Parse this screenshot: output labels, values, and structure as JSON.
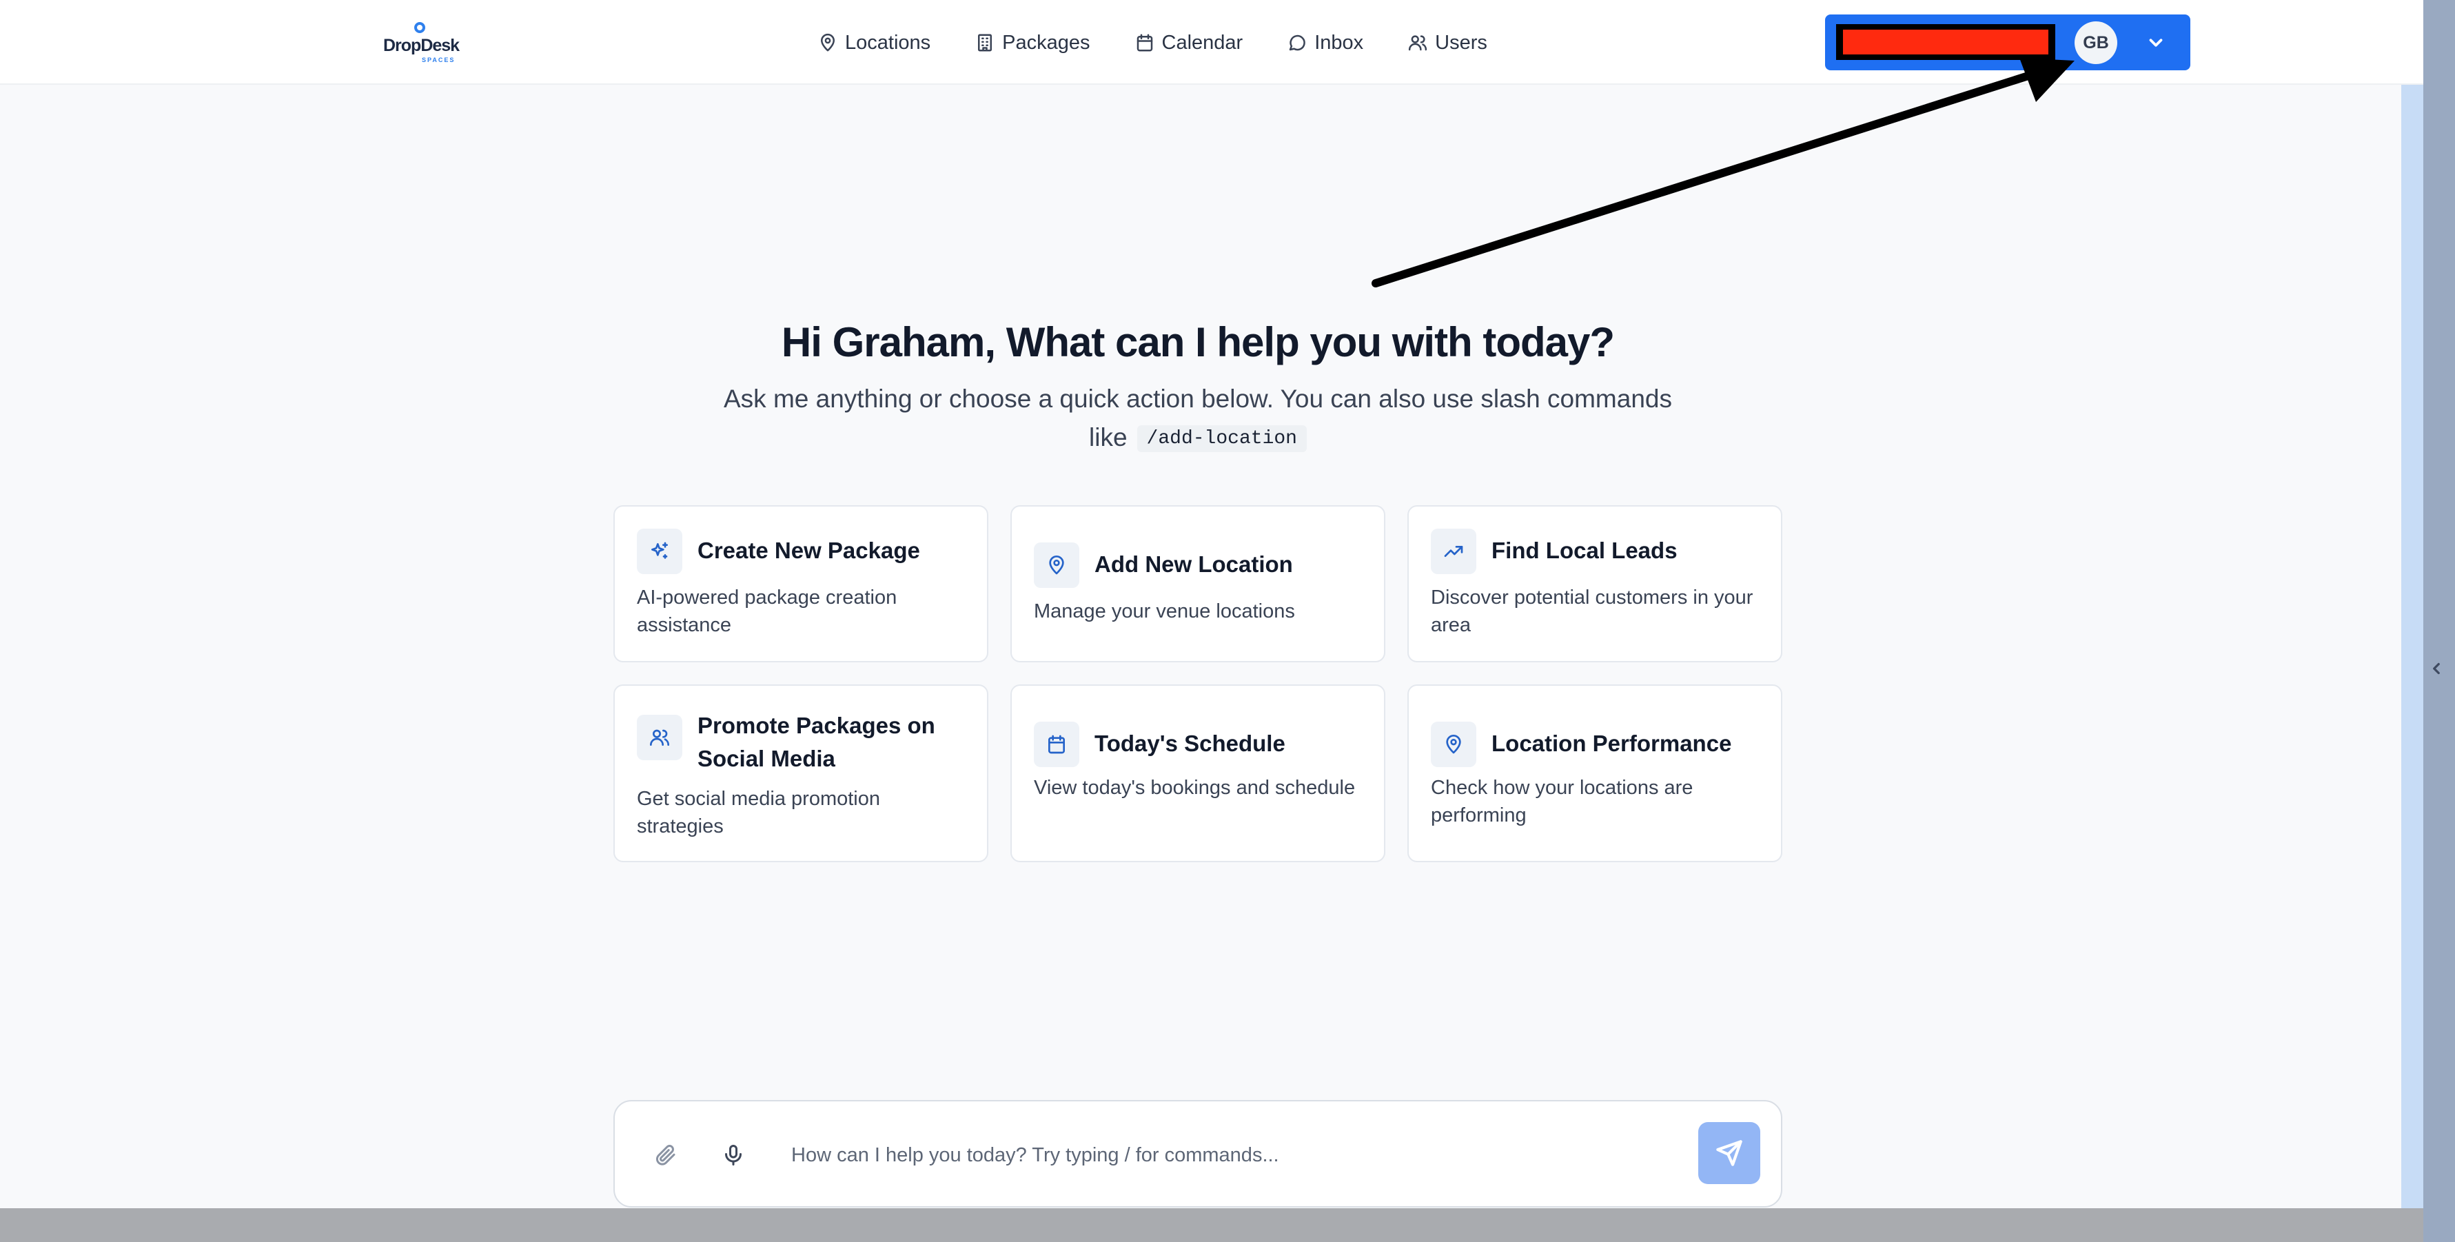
{
  "brand": {
    "name": "DropDesk",
    "sub": "SPACES"
  },
  "nav": [
    {
      "label": "Locations",
      "icon": "map-pin-icon"
    },
    {
      "label": "Packages",
      "icon": "building-icon"
    },
    {
      "label": "Calendar",
      "icon": "calendar-icon"
    },
    {
      "label": "Inbox",
      "icon": "message-circle-icon"
    },
    {
      "label": "Users",
      "icon": "users-icon"
    }
  ],
  "account": {
    "initials": "GB",
    "accent": "#1f6ff2"
  },
  "greeting": {
    "title": "Hi Graham, What can I help you with today?",
    "subtitle_line1": "Ask me anything or choose a quick action below. You can also use slash commands",
    "subtitle_like": "like",
    "command": "/add-location"
  },
  "actions": [
    {
      "title": "Create New Package",
      "description": "AI-powered package creation assistance",
      "icon": "sparkles-icon"
    },
    {
      "title": "Add New Location",
      "description": "Manage your venue locations",
      "icon": "map-pin-icon"
    },
    {
      "title": "Find Local Leads",
      "description": "Discover potential customers in your area",
      "icon": "trending-up-icon"
    },
    {
      "title": "Promote Packages on Social Media",
      "description": "Get social media promotion strategies",
      "icon": "users-icon"
    },
    {
      "title": "Today's Schedule",
      "description": "View today's bookings and schedule",
      "icon": "calendar-icon"
    },
    {
      "title": "Location Performance",
      "description": "Check how your locations are performing",
      "icon": "map-pin-icon"
    }
  ],
  "chat": {
    "placeholder": "How can I help you today? Try typing / for commands..."
  }
}
